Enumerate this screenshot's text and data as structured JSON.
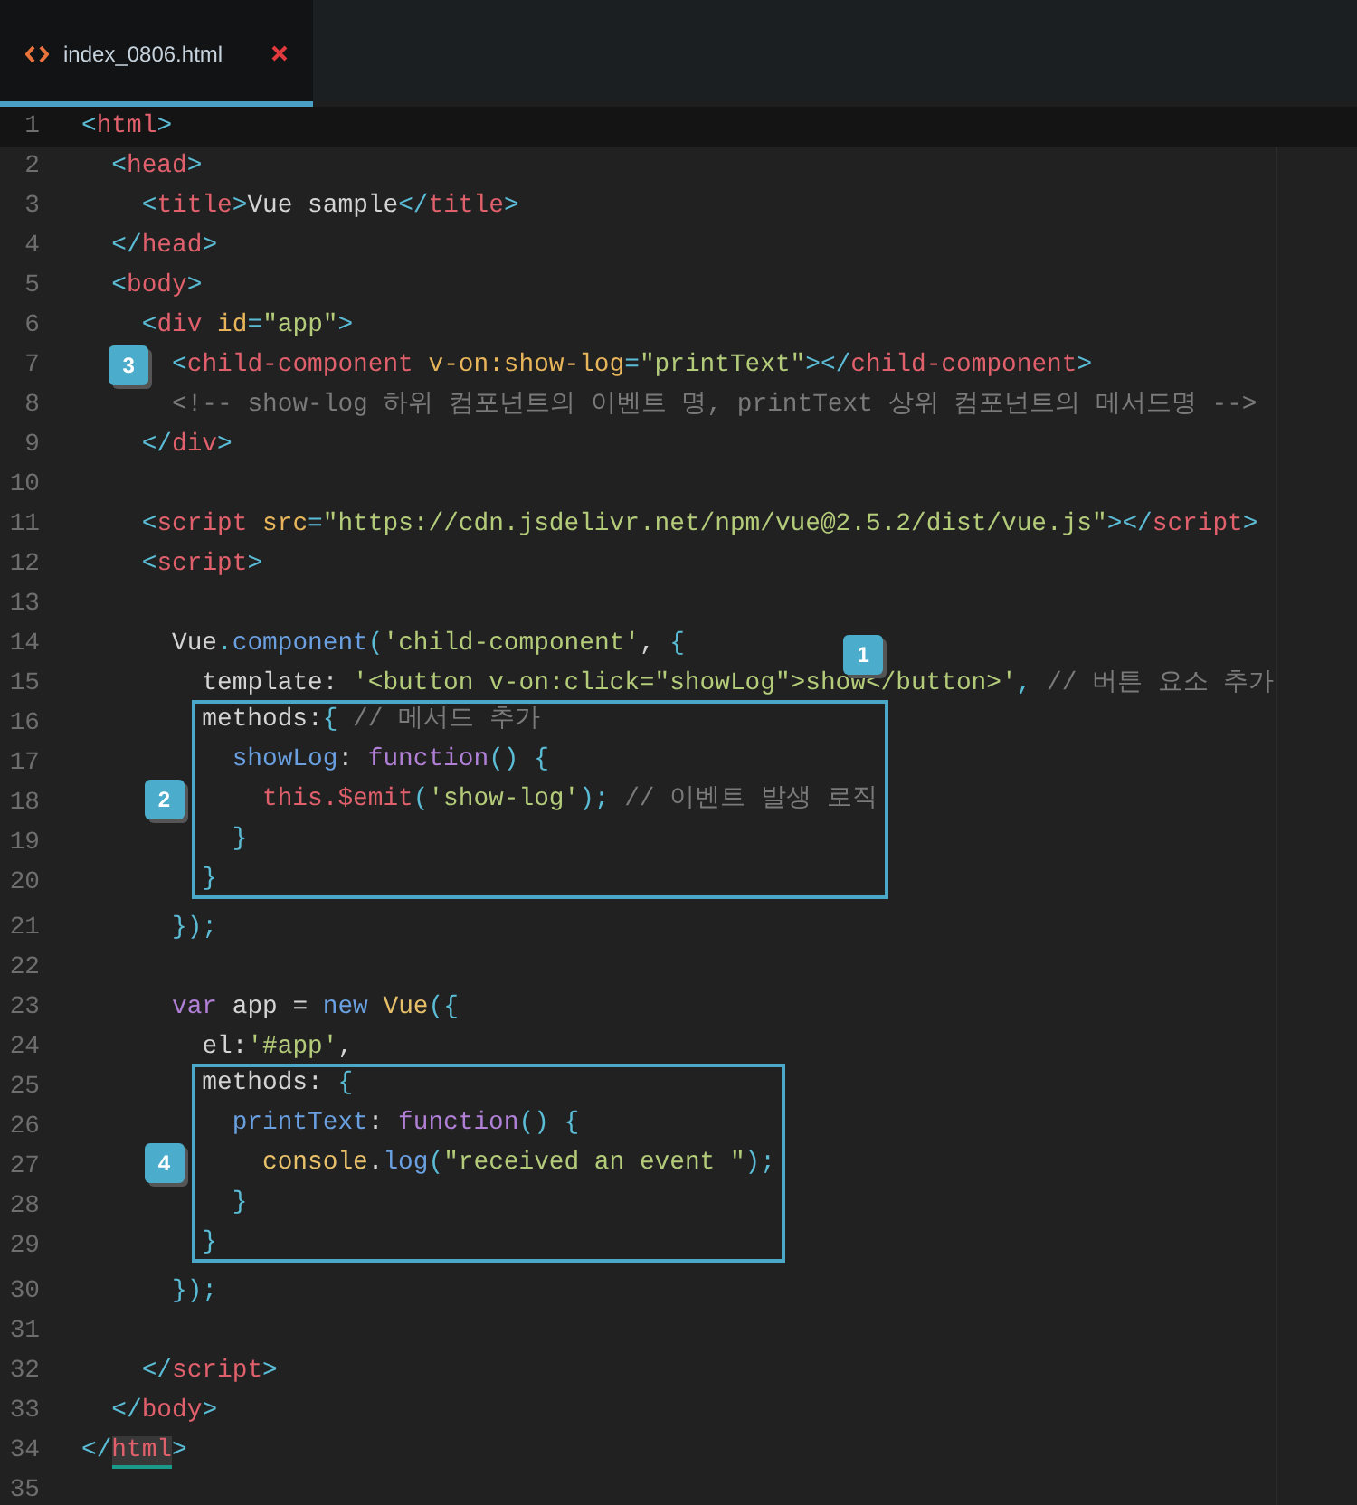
{
  "tab": {
    "title": "index_0806.html",
    "selected": true
  },
  "blocks": [
    {
      "kind": "plain",
      "lines": [
        {
          "number": "1",
          "current": true,
          "tokens": [
            {
              "kind": "b",
              "t": "<"
            },
            {
              "kind": "tag",
              "t": "html"
            },
            {
              "kind": "b",
              "t": ">"
            }
          ]
        },
        {
          "number": "2",
          "current": false,
          "tokens": [
            {
              "kind": "b",
              "t": "  <"
            },
            {
              "kind": "tag",
              "t": "head"
            },
            {
              "kind": "b",
              "t": ">"
            }
          ]
        },
        {
          "number": "3",
          "current": false,
          "tokens": [
            {
              "kind": "b",
              "t": "    <"
            },
            {
              "kind": "tag",
              "t": "title"
            },
            {
              "kind": "b",
              "t": ">"
            },
            {
              "kind": "txt",
              "t": "Vue sample"
            },
            {
              "kind": "b",
              "t": "</"
            },
            {
              "kind": "tag",
              "t": "title"
            },
            {
              "kind": "b",
              "t": ">"
            }
          ]
        },
        {
          "number": "4",
          "current": false,
          "tokens": [
            {
              "kind": "b",
              "t": "  </"
            },
            {
              "kind": "tag",
              "t": "head"
            },
            {
              "kind": "b",
              "t": ">"
            }
          ]
        },
        {
          "number": "5",
          "current": false,
          "tokens": [
            {
              "kind": "b",
              "t": "  <"
            },
            {
              "kind": "tag",
              "t": "body"
            },
            {
              "kind": "b",
              "t": ">"
            }
          ]
        },
        {
          "number": "6",
          "current": false,
          "tokens": [
            {
              "kind": "b",
              "t": "    <"
            },
            {
              "kind": "tag",
              "t": "div"
            },
            {
              "kind": "attr",
              "t": " id"
            },
            {
              "kind": "b",
              "t": "="
            },
            {
              "kind": "str",
              "t": "\"app\""
            },
            {
              "kind": "b",
              "t": ">"
            }
          ]
        },
        {
          "number": "7",
          "current": false,
          "tokens": [
            {
              "kind": "b",
              "t": "      <",
              "badge": {
                "label": "3",
                "kind": "gutter"
              }
            },
            {
              "kind": "tag",
              "t": "child-component"
            },
            {
              "kind": "attr",
              "t": " v-on:show-log"
            },
            {
              "kind": "b",
              "t": "="
            },
            {
              "kind": "str",
              "t": "\"printText\""
            },
            {
              "kind": "b",
              "t": "></"
            },
            {
              "kind": "tag",
              "t": "child-component"
            },
            {
              "kind": "b",
              "t": ">"
            }
          ]
        },
        {
          "number": "8",
          "current": false,
          "tokens": [
            {
              "kind": "cm",
              "t": "      <!-- show-log 하위 컴포넌트의 이벤트 명, printText 상위 컴포넌트의 메서드명 -->"
            }
          ]
        },
        {
          "number": "9",
          "current": false,
          "tokens": [
            {
              "kind": "b",
              "t": "    </"
            },
            {
              "kind": "tag",
              "t": "div"
            },
            {
              "kind": "b",
              "t": ">"
            }
          ]
        },
        {
          "number": "10",
          "current": false
        },
        {
          "number": "11",
          "current": false,
          "tokens": [
            {
              "kind": "b",
              "t": "    <"
            },
            {
              "kind": "tag",
              "t": "script"
            },
            {
              "kind": "attr",
              "t": " src"
            },
            {
              "kind": "b",
              "t": "="
            },
            {
              "kind": "str",
              "t": "\"https://cdn.jsdelivr.net/npm/vue@2.5.2/dist/vue.js\""
            },
            {
              "kind": "b",
              "t": "></"
            },
            {
              "kind": "tag",
              "t": "script"
            },
            {
              "kind": "b",
              "t": ">"
            }
          ]
        },
        {
          "number": "12",
          "current": false,
          "tokens": [
            {
              "kind": "b",
              "t": "    <"
            },
            {
              "kind": "tag",
              "t": "script"
            },
            {
              "kind": "b",
              "t": ">"
            }
          ]
        },
        {
          "number": "13",
          "current": false
        },
        {
          "number": "14",
          "current": false,
          "tokens": [
            {
              "kind": "txt",
              "t": "      Vue"
            },
            {
              "kind": "b",
              "t": "."
            },
            {
              "kind": "fn",
              "t": "component"
            },
            {
              "kind": "b",
              "t": "("
            },
            {
              "kind": "str",
              "t": "'child-component'"
            },
            {
              "kind": "txt",
              "t": ", "
            },
            {
              "kind": "b",
              "t": "{"
            }
          ]
        },
        {
          "number": "15",
          "current": false,
          "tokens": [
            {
              "kind": "txt",
              "t": "        template: "
            },
            {
              "kind": "str",
              "t": "'<button v-on:click=\"showLog\">show</button>'"
            },
            {
              "kind": "b",
              "t": ","
            },
            {
              "kind": "cm",
              "t": " // 버튼 요소 추가",
              "badge": {
                "label": "1",
                "kind": "raised"
              }
            }
          ]
        }
      ]
    },
    {
      "kind": "boxed",
      "badge": "2",
      "lines": [
        {
          "number": "16",
          "current": false,
          "tokens": [
            {
              "kind": "txt",
              "t": "methods:"
            },
            {
              "kind": "b",
              "t": "{"
            },
            {
              "kind": "cm",
              "t": " // 메서드 추가"
            }
          ]
        },
        {
          "number": "17",
          "current": false,
          "tokens": [
            {
              "kind": "fn",
              "t": "  showLog"
            },
            {
              "kind": "txt",
              "t": ": "
            },
            {
              "kind": "kw",
              "t": "function"
            },
            {
              "kind": "b",
              "t": "() {"
            }
          ]
        },
        {
          "number": "18",
          "current": false,
          "tokens": [
            {
              "kind": "self",
              "t": "    this"
            },
            {
              "kind": "self",
              "t": ".$emit"
            },
            {
              "kind": "b",
              "t": "("
            },
            {
              "kind": "str",
              "t": "'show-log'"
            },
            {
              "kind": "b",
              "t": ");"
            },
            {
              "kind": "cm",
              "t": " // 이벤트 발생 로직"
            }
          ]
        },
        {
          "number": "19",
          "current": false,
          "tokens": [
            {
              "kind": "b",
              "t": "  }"
            }
          ]
        },
        {
          "number": "20",
          "current": false,
          "tokens": [
            {
              "kind": "b",
              "t": "}"
            }
          ]
        }
      ]
    },
    {
      "kind": "plain",
      "lines": [
        {
          "number": "21",
          "current": false,
          "tokens": [
            {
              "kind": "b",
              "t": "      });"
            }
          ]
        },
        {
          "number": "22",
          "current": false
        },
        {
          "number": "23",
          "current": false,
          "tokens": [
            {
              "kind": "kw",
              "t": "      var"
            },
            {
              "kind": "txt",
              "t": " app = "
            },
            {
              "kind": "fn",
              "t": "new"
            },
            {
              "kind": "obj",
              "t": " Vue"
            },
            {
              "kind": "b",
              "t": "({"
            }
          ]
        },
        {
          "number": "24",
          "current": false,
          "tokens": [
            {
              "kind": "txt",
              "t": "        el:"
            },
            {
              "kind": "str",
              "t": "'#app'"
            },
            {
              "kind": "txt",
              "t": ","
            }
          ]
        }
      ]
    },
    {
      "kind": "boxed",
      "badge": "4",
      "lines": [
        {
          "number": "25",
          "current": false,
          "tokens": [
            {
              "kind": "txt",
              "t": "methods: "
            },
            {
              "kind": "b",
              "t": "{"
            }
          ]
        },
        {
          "number": "26",
          "current": false,
          "tokens": [
            {
              "kind": "fn",
              "t": "  printText"
            },
            {
              "kind": "txt",
              "t": ": "
            },
            {
              "kind": "kw",
              "t": "function"
            },
            {
              "kind": "b",
              "t": "() {"
            }
          ]
        },
        {
          "number": "27",
          "current": false,
          "tokens": [
            {
              "kind": "obj",
              "t": "    console"
            },
            {
              "kind": "txt",
              "t": "."
            },
            {
              "kind": "fn",
              "t": "log"
            },
            {
              "kind": "b",
              "t": "("
            },
            {
              "kind": "str",
              "t": "\"received an event \""
            },
            {
              "kind": "b",
              "t": ");"
            }
          ]
        },
        {
          "number": "28",
          "current": false,
          "tokens": [
            {
              "kind": "b",
              "t": "  }"
            }
          ]
        },
        {
          "number": "29",
          "current": false,
          "tokens": [
            {
              "kind": "b",
              "t": "}"
            }
          ]
        }
      ]
    },
    {
      "kind": "plain",
      "lines": [
        {
          "number": "30",
          "current": false,
          "tokens": [
            {
              "kind": "b",
              "t": "      });"
            }
          ]
        },
        {
          "number": "31",
          "current": false
        },
        {
          "number": "32",
          "current": false,
          "tokens": [
            {
              "kind": "b",
              "t": "    </"
            },
            {
              "kind": "tag",
              "t": "script"
            },
            {
              "kind": "b",
              "t": ">"
            }
          ]
        },
        {
          "number": "33",
          "current": false,
          "tokens": [
            {
              "kind": "b",
              "t": "  </"
            },
            {
              "kind": "tag",
              "t": "body"
            },
            {
              "kind": "b",
              "t": ">"
            }
          ]
        },
        {
          "number": "34",
          "current": false,
          "tokens": [
            {
              "kind": "b",
              "t": "</"
            },
            {
              "kind": "match",
              "t": "html"
            },
            {
              "kind": "b",
              "t": ">"
            }
          ]
        },
        {
          "number": "35",
          "current": false
        }
      ]
    }
  ]
}
